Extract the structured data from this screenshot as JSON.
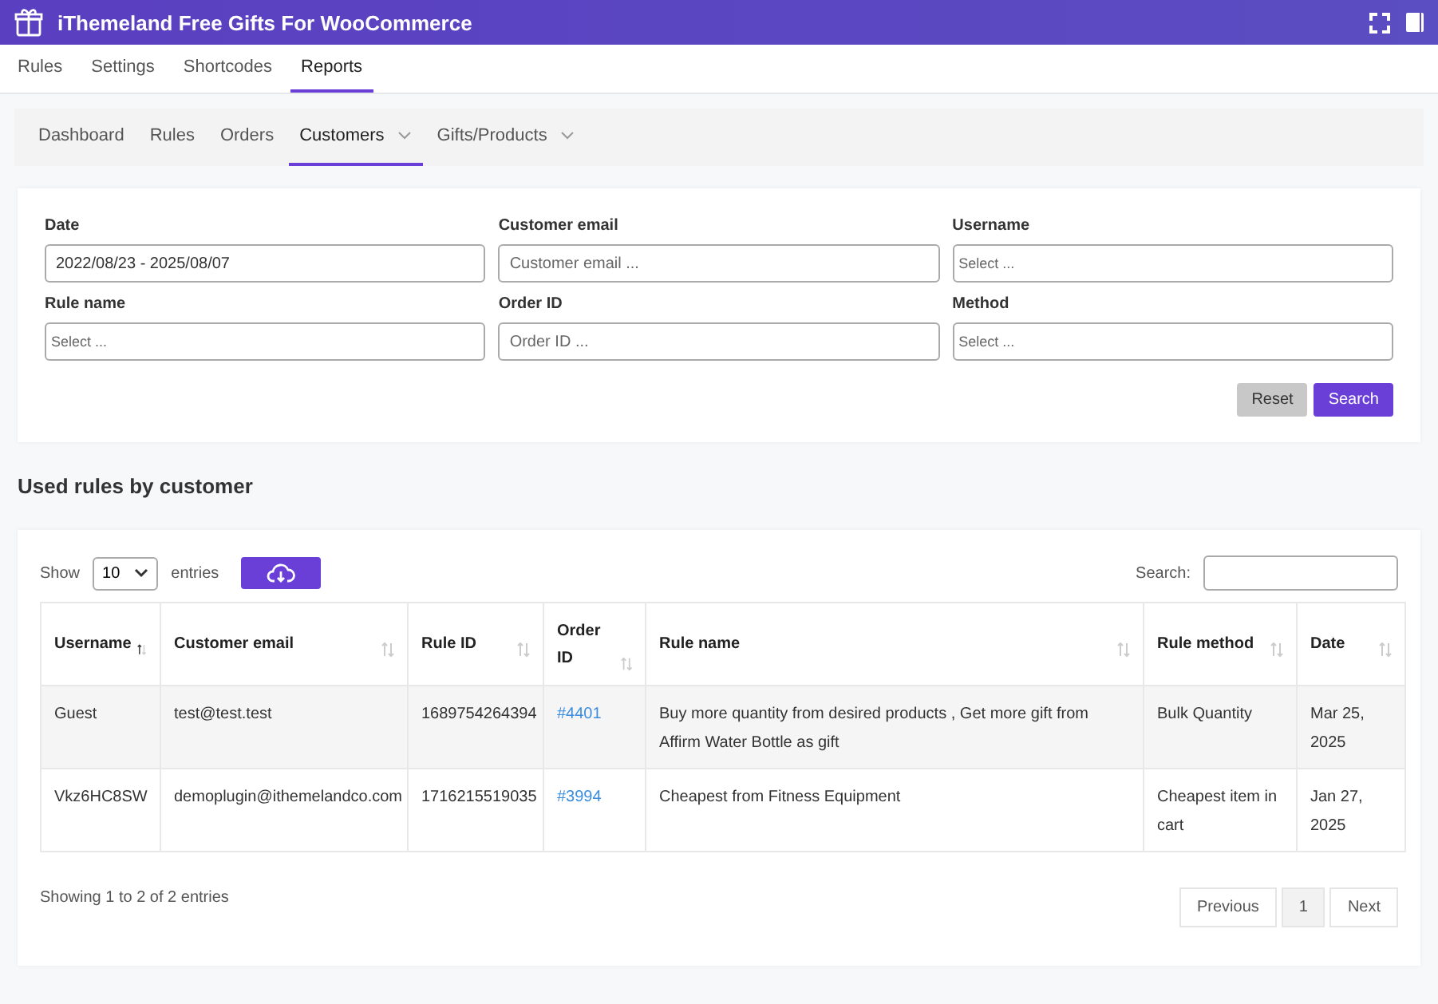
{
  "header": {
    "title": "iThemeland Free Gifts For WooCommerce"
  },
  "tabs": [
    {
      "label": "Rules",
      "selected": false
    },
    {
      "label": "Settings",
      "selected": false
    },
    {
      "label": "Shortcodes",
      "selected": false
    },
    {
      "label": "Reports",
      "selected": true
    }
  ],
  "subnav": [
    {
      "label": "Dashboard",
      "selected": false,
      "has_menu": false
    },
    {
      "label": "Rules",
      "selected": false,
      "has_menu": false
    },
    {
      "label": "Orders",
      "selected": false,
      "has_menu": false
    },
    {
      "label": "Customers",
      "selected": true,
      "has_menu": true
    },
    {
      "label": "Gifts/Products",
      "selected": false,
      "has_menu": true
    }
  ],
  "filters": [
    {
      "label": "Date",
      "kind": "text",
      "value": "2022/08/23 - 2025/08/07"
    },
    {
      "label": "Customer email",
      "kind": "text",
      "placeholder": "Customer email ..."
    },
    {
      "label": "Username",
      "kind": "select",
      "placeholder": "Select ..."
    },
    {
      "label": "Rule name",
      "kind": "select",
      "placeholder": "Select ..."
    },
    {
      "label": "Order ID",
      "kind": "text",
      "placeholder": "Order ID ..."
    },
    {
      "label": "Method",
      "kind": "select",
      "placeholder": "Select ..."
    }
  ],
  "filter_buttons": {
    "reset": "Reset",
    "search": "Search"
  },
  "section_title": "Used rules by customer",
  "table": {
    "show_label": "Show",
    "page_size": "10",
    "entries_label": "entries",
    "search_label": "Search:",
    "columns": [
      {
        "label": "Username",
        "sorted": true
      },
      {
        "label": "Customer email",
        "sorted": false
      },
      {
        "label": "Rule ID",
        "sorted": false
      },
      {
        "label": "Order ID",
        "sorted": false
      },
      {
        "label": "Rule name",
        "sorted": false
      },
      {
        "label": "Rule method",
        "sorted": false
      },
      {
        "label": "Date",
        "sorted": false
      }
    ],
    "rows": [
      [
        "Guest",
        "test@test.test",
        "1689754264394",
        "#4401",
        "Buy more quantity from desired products , Get more gift from Affirm Water Bottle as gift",
        "Bulk Quantity",
        "Mar 25, 2025"
      ],
      [
        "Vkz6HC8SW",
        "demoplugin@ithemelandco.com",
        "1716215519035",
        "#3994",
        "Cheapest from Fitness Equipment",
        "Cheapest item in cart",
        "Jan 27, 2025"
      ]
    ],
    "info": "Showing 1 to 2 of 2 entries",
    "previous": "Previous",
    "next": "Next",
    "pages": [
      {
        "label": "1",
        "selected": true
      }
    ]
  }
}
